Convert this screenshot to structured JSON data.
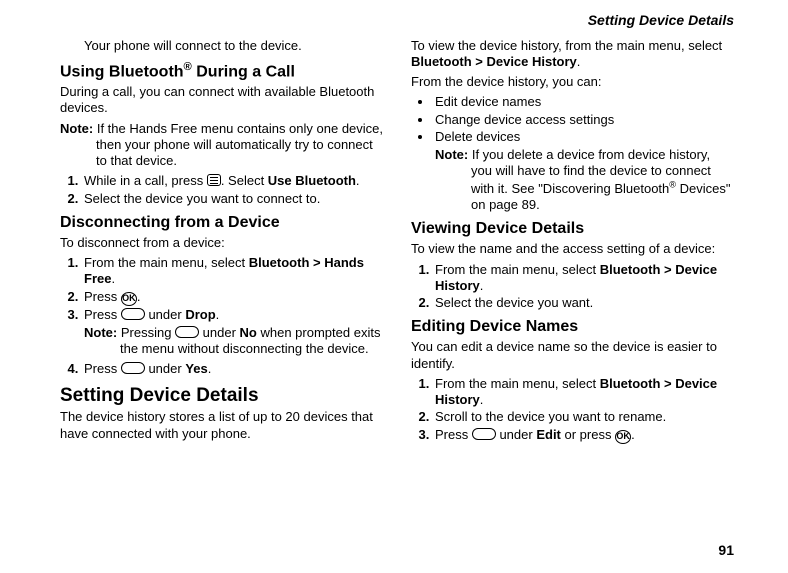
{
  "running_head": "Setting Device Details",
  "page_number": "91",
  "left": {
    "p_connect": "Your phone will connect to the device.",
    "h_using": "Using Bluetooth",
    "h_using_reg": "®",
    "h_using_tail": " During a Call",
    "p_during": "During a call, you can connect with available Bluetooth devices.",
    "note1_label": "Note:",
    "note1_body": "If the Hands Free menu contains only one device, then your phone will automatically try to connect to that device.",
    "li1_pre": "While in a call, press ",
    "li1_mid": ".  Select ",
    "li1_bold": "Use Bluetooth",
    "li1_post": ".",
    "li2": "Select the device you want to connect to.",
    "h_disconnect": "Disconnecting from a Device",
    "p_todisc": "To disconnect from a device:",
    "d1_pre": "From the main menu, select ",
    "d1_bold": "Bluetooth > Hands Free",
    "d1_post": ".",
    "d2_pre": "Press ",
    "d2_post": ".",
    "d3_pre": "Press ",
    "d3_mid": " under ",
    "d3_bold": "Drop",
    "d3_post": ".",
    "dnote_label": "Note:",
    "dnote_pre": "Pressing ",
    "dnote_mid": " under ",
    "dnote_bold": "No",
    "dnote_post": " when prompted exits the menu without disconnecting the device.",
    "d4_pre": "Press ",
    "d4_mid": " under ",
    "d4_bold": "Yes",
    "d4_post": ".",
    "h_setting": "Setting Device Details",
    "p_history": "The device history stores a list of up to 20 devices that have connected with your phone."
  },
  "right": {
    "p_toview_pre": "To view the device history, from the main menu, select ",
    "p_toview_bold": "Bluetooth > Device History",
    "p_toview_post": ".",
    "p_fromhist": "From the device history, you can:",
    "b1": "Edit device names",
    "b2": "Change device access settings",
    "b3": "Delete devices",
    "rnote_label": "Note:",
    "rnote_body_pre": "If you delete a device from device history, you will have to find the device to connect with it. See \"Discovering Bluetooth",
    "rnote_reg": "®",
    "rnote_body_post": " Devices\" on page 89.",
    "h_viewing": "Viewing Device Details",
    "p_viewing": "To view the name and the access setting of a device:",
    "v1_pre": "From the main menu, select ",
    "v1_bold": "Bluetooth > Device History",
    "v1_post": ".",
    "v2": "Select the device you want.",
    "h_editing": "Editing Device Names",
    "p_editing": "You can edit a device name so the device is easier to identify.",
    "e1_pre": "From the main menu, select ",
    "e1_bold": "Bluetooth > Device History",
    "e1_post": ".",
    "e2": "Scroll to the device you want to rename.",
    "e3_pre": "Press ",
    "e3_mid": " under ",
    "e3_bold": "Edit",
    "e3_mid2": " or press ",
    "e3_post": ".",
    "ok_label": "OK"
  }
}
